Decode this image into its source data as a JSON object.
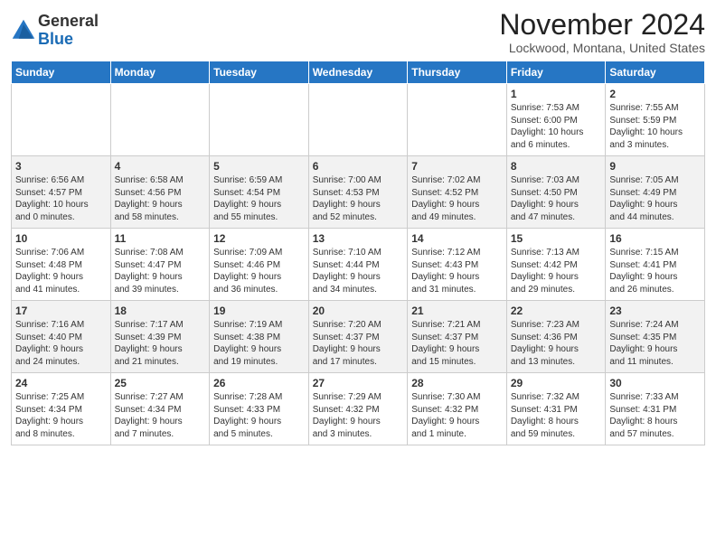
{
  "header": {
    "logo_general": "General",
    "logo_blue": "Blue",
    "month_title": "November 2024",
    "location": "Lockwood, Montana, United States"
  },
  "columns": [
    "Sunday",
    "Monday",
    "Tuesday",
    "Wednesday",
    "Thursday",
    "Friday",
    "Saturday"
  ],
  "weeks": [
    [
      {
        "day": "",
        "info": ""
      },
      {
        "day": "",
        "info": ""
      },
      {
        "day": "",
        "info": ""
      },
      {
        "day": "",
        "info": ""
      },
      {
        "day": "",
        "info": ""
      },
      {
        "day": "1",
        "info": "Sunrise: 7:53 AM\nSunset: 6:00 PM\nDaylight: 10 hours\nand 6 minutes."
      },
      {
        "day": "2",
        "info": "Sunrise: 7:55 AM\nSunset: 5:59 PM\nDaylight: 10 hours\nand 3 minutes."
      }
    ],
    [
      {
        "day": "3",
        "info": "Sunrise: 6:56 AM\nSunset: 4:57 PM\nDaylight: 10 hours\nand 0 minutes."
      },
      {
        "day": "4",
        "info": "Sunrise: 6:58 AM\nSunset: 4:56 PM\nDaylight: 9 hours\nand 58 minutes."
      },
      {
        "day": "5",
        "info": "Sunrise: 6:59 AM\nSunset: 4:54 PM\nDaylight: 9 hours\nand 55 minutes."
      },
      {
        "day": "6",
        "info": "Sunrise: 7:00 AM\nSunset: 4:53 PM\nDaylight: 9 hours\nand 52 minutes."
      },
      {
        "day": "7",
        "info": "Sunrise: 7:02 AM\nSunset: 4:52 PM\nDaylight: 9 hours\nand 49 minutes."
      },
      {
        "day": "8",
        "info": "Sunrise: 7:03 AM\nSunset: 4:50 PM\nDaylight: 9 hours\nand 47 minutes."
      },
      {
        "day": "9",
        "info": "Sunrise: 7:05 AM\nSunset: 4:49 PM\nDaylight: 9 hours\nand 44 minutes."
      }
    ],
    [
      {
        "day": "10",
        "info": "Sunrise: 7:06 AM\nSunset: 4:48 PM\nDaylight: 9 hours\nand 41 minutes."
      },
      {
        "day": "11",
        "info": "Sunrise: 7:08 AM\nSunset: 4:47 PM\nDaylight: 9 hours\nand 39 minutes."
      },
      {
        "day": "12",
        "info": "Sunrise: 7:09 AM\nSunset: 4:46 PM\nDaylight: 9 hours\nand 36 minutes."
      },
      {
        "day": "13",
        "info": "Sunrise: 7:10 AM\nSunset: 4:44 PM\nDaylight: 9 hours\nand 34 minutes."
      },
      {
        "day": "14",
        "info": "Sunrise: 7:12 AM\nSunset: 4:43 PM\nDaylight: 9 hours\nand 31 minutes."
      },
      {
        "day": "15",
        "info": "Sunrise: 7:13 AM\nSunset: 4:42 PM\nDaylight: 9 hours\nand 29 minutes."
      },
      {
        "day": "16",
        "info": "Sunrise: 7:15 AM\nSunset: 4:41 PM\nDaylight: 9 hours\nand 26 minutes."
      }
    ],
    [
      {
        "day": "17",
        "info": "Sunrise: 7:16 AM\nSunset: 4:40 PM\nDaylight: 9 hours\nand 24 minutes."
      },
      {
        "day": "18",
        "info": "Sunrise: 7:17 AM\nSunset: 4:39 PM\nDaylight: 9 hours\nand 21 minutes."
      },
      {
        "day": "19",
        "info": "Sunrise: 7:19 AM\nSunset: 4:38 PM\nDaylight: 9 hours\nand 19 minutes."
      },
      {
        "day": "20",
        "info": "Sunrise: 7:20 AM\nSunset: 4:37 PM\nDaylight: 9 hours\nand 17 minutes."
      },
      {
        "day": "21",
        "info": "Sunrise: 7:21 AM\nSunset: 4:37 PM\nDaylight: 9 hours\nand 15 minutes."
      },
      {
        "day": "22",
        "info": "Sunrise: 7:23 AM\nSunset: 4:36 PM\nDaylight: 9 hours\nand 13 minutes."
      },
      {
        "day": "23",
        "info": "Sunrise: 7:24 AM\nSunset: 4:35 PM\nDaylight: 9 hours\nand 11 minutes."
      }
    ],
    [
      {
        "day": "24",
        "info": "Sunrise: 7:25 AM\nSunset: 4:34 PM\nDaylight: 9 hours\nand 8 minutes."
      },
      {
        "day": "25",
        "info": "Sunrise: 7:27 AM\nSunset: 4:34 PM\nDaylight: 9 hours\nand 7 minutes."
      },
      {
        "day": "26",
        "info": "Sunrise: 7:28 AM\nSunset: 4:33 PM\nDaylight: 9 hours\nand 5 minutes."
      },
      {
        "day": "27",
        "info": "Sunrise: 7:29 AM\nSunset: 4:32 PM\nDaylight: 9 hours\nand 3 minutes."
      },
      {
        "day": "28",
        "info": "Sunrise: 7:30 AM\nSunset: 4:32 PM\nDaylight: 9 hours\nand 1 minute."
      },
      {
        "day": "29",
        "info": "Sunrise: 7:32 AM\nSunset: 4:31 PM\nDaylight: 8 hours\nand 59 minutes."
      },
      {
        "day": "30",
        "info": "Sunrise: 7:33 AM\nSunset: 4:31 PM\nDaylight: 8 hours\nand 57 minutes."
      }
    ]
  ]
}
